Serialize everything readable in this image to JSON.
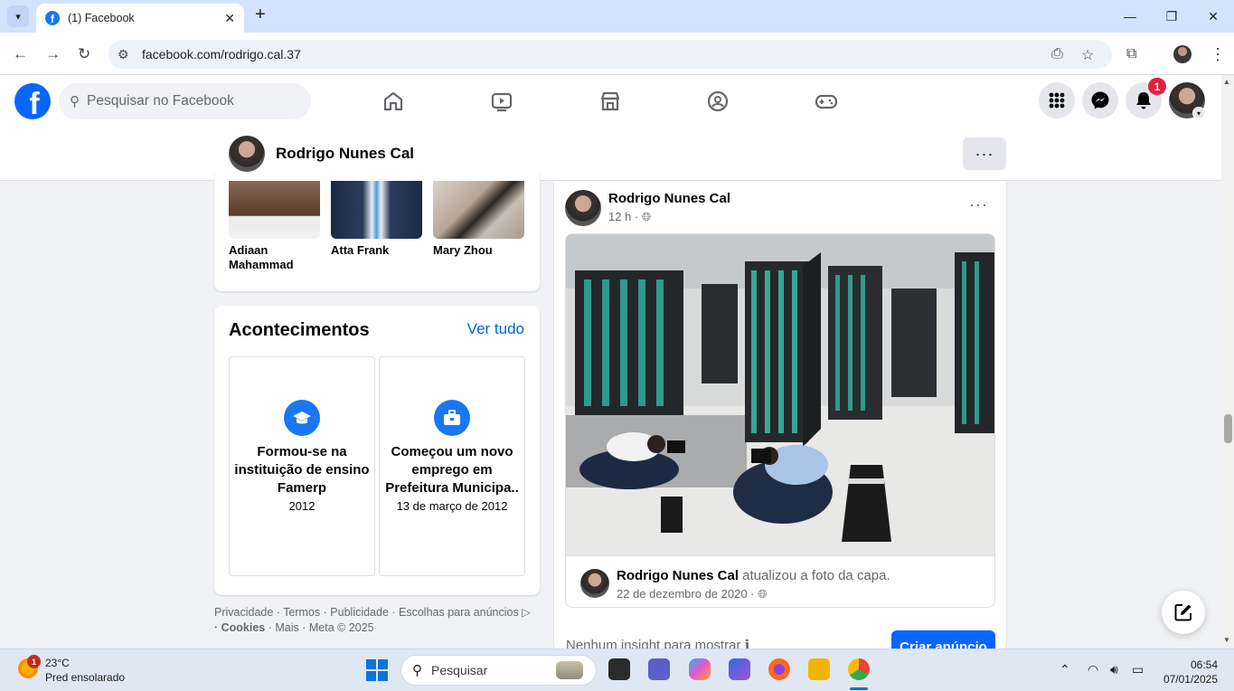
{
  "browser": {
    "tab_title": "(1) Facebook",
    "url": "facebook.com/rodrigo.cal.37"
  },
  "fb_nav": {
    "search_placeholder": "Pesquisar no Facebook",
    "notification_count": "1"
  },
  "profile_bar": {
    "name": "Rodrigo Nunes Cal",
    "more": "···"
  },
  "friends": [
    {
      "name": "Adiaan Mahammad"
    },
    {
      "name": "Atta Frank"
    },
    {
      "name": "Mary Zhou"
    }
  ],
  "events": {
    "title": "Acontecimentos",
    "see_all": "Ver tudo",
    "items": [
      {
        "text": "Formou-se na instituição de ensino Famerp",
        "date": "2012",
        "icon": "graduation-cap-icon"
      },
      {
        "text": "Começou um novo emprego em Prefeitura Municipa..",
        "date": "13 de março de 2012",
        "icon": "briefcase-icon"
      }
    ]
  },
  "footer": {
    "line1": "Privacidade · Termos · Publicidade · Escolhas para anúncios ▷",
    "line2_cookies": "· Cookies",
    "line2_rest": " · Mais · Meta © 2025"
  },
  "post": {
    "author": "Rodrigo Nunes Cal",
    "time": "12 h · ",
    "more": "···",
    "sub_author": "Rodrigo Nunes Cal",
    "sub_action": " atualizou a foto da capa.",
    "sub_date": "22 de dezembro de 2020 · ",
    "insight": "Nenhum insight para mostrar",
    "ad_button": "Criar anúncio"
  },
  "taskbar": {
    "temp": "23°C",
    "weather": "Pred ensolarado",
    "weather_badge": "1",
    "search": "Pesquisar",
    "time": "06:54",
    "date": "07/01/2025"
  },
  "colors": {
    "fb_blue": "#0866ff",
    "link_blue": "#0064d1",
    "badge_red": "#e41e3f"
  }
}
